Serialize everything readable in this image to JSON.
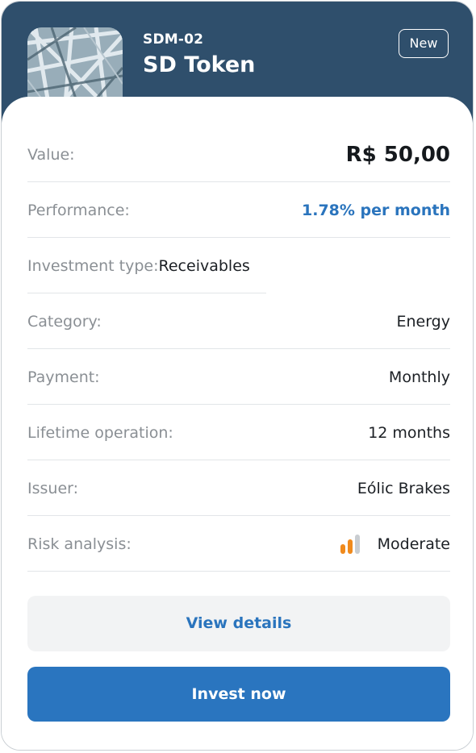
{
  "header": {
    "code": "SDM-02",
    "title": "SD Token",
    "badge": "New",
    "thumbnail_icon": "steel-frame-image"
  },
  "details": {
    "value": {
      "label": "Value:",
      "value": "R$ 50,00"
    },
    "performance": {
      "label": "Performance:",
      "value": "1.78% per month",
      "color": "#2a74bd"
    },
    "investment_type": {
      "label": "Investment type:",
      "value": "Receivables"
    },
    "category": {
      "label": "Category:",
      "value": "Energy"
    },
    "payment": {
      "label": "Payment:",
      "value": "Monthly"
    },
    "lifetime": {
      "label": "Lifetime operation:",
      "value": "12 months"
    },
    "issuer": {
      "label": "Issuer:",
      "value": "Eólic Brakes"
    },
    "risk": {
      "label": "Risk analysis:",
      "value": "Moderate",
      "icon": "risk-bars-icon",
      "level_bars": 2,
      "total_bars": 3,
      "color": "#f08a1c"
    }
  },
  "actions": {
    "view_details": "View details",
    "invest_now": "Invest now"
  },
  "colors": {
    "header_bg": "#2f4f6c",
    "primary": "#2a75bf"
  }
}
